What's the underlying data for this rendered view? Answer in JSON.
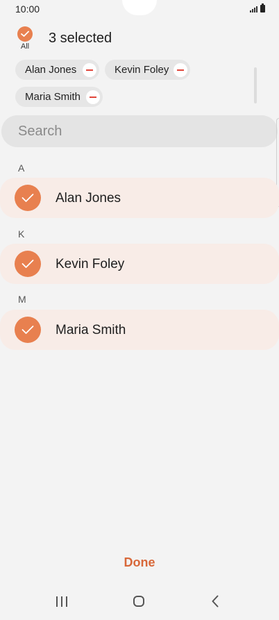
{
  "status_bar": {
    "time": "10:00"
  },
  "header": {
    "all_label": "All",
    "selected_count": "3 selected"
  },
  "chips": [
    {
      "label": "Alan Jones"
    },
    {
      "label": "Kevin Foley"
    },
    {
      "label": "Maria Smith"
    }
  ],
  "search": {
    "placeholder": "Search"
  },
  "sections": [
    {
      "letter": "A",
      "contact": "Alan Jones",
      "selected": true
    },
    {
      "letter": "K",
      "contact": "Kevin Foley",
      "selected": true
    },
    {
      "letter": "M",
      "contact": "Maria Smith",
      "selected": true
    }
  ],
  "footer": {
    "done_label": "Done"
  },
  "colors": {
    "accent": "#e8804f",
    "done_text": "#d8683a",
    "row_highlight": "#f8ece7",
    "remove_icon": "#e0453a"
  },
  "icons": [
    "signal-icon",
    "battery-icon",
    "check-icon",
    "minus-icon",
    "recents-icon",
    "home-icon",
    "back-icon"
  ]
}
